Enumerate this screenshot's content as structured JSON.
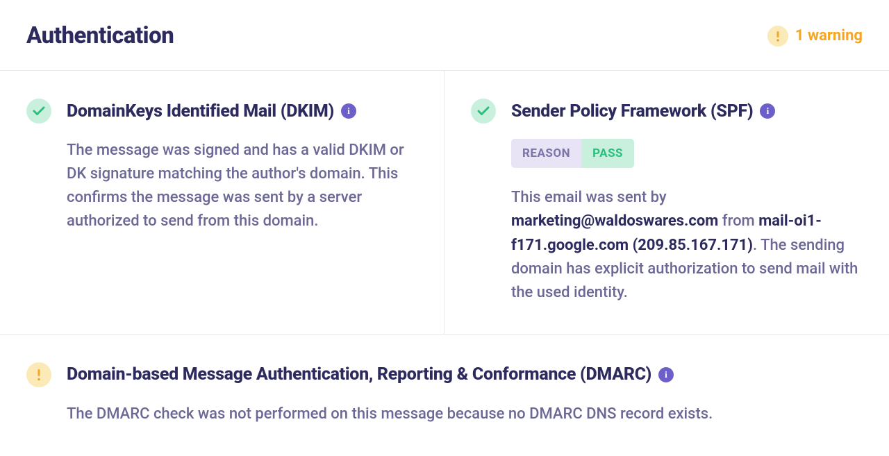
{
  "header": {
    "title": "Authentication",
    "warning_count_text": "1 warning"
  },
  "dkim": {
    "title": "DomainKeys Identified Mail (DKIM)",
    "status": "pass",
    "description": "The message was signed and has a valid DKIM or DK signature matching the author's domain. This confirms the message was sent by a server authorized to send from this domain."
  },
  "spf": {
    "title": "Sender Policy Framework (SPF)",
    "status": "pass",
    "reason_label": "REASON",
    "reason_value": "PASS",
    "desc_part1": "This email was sent by ",
    "sender_email": "marketing@waldoswares.com",
    "desc_part2": " from ",
    "sending_host": "mail-oi1-f171.google.com (209.85.167.171)",
    "desc_part3": ". The sending domain has explicit authorization to send mail with the used identity."
  },
  "dmarc": {
    "title": "Domain-based Message Authentication, Reporting & Conformance (DMARC)",
    "status": "warning",
    "description": "The DMARC check was not performed on this message because no DMARC DNS record exists."
  }
}
